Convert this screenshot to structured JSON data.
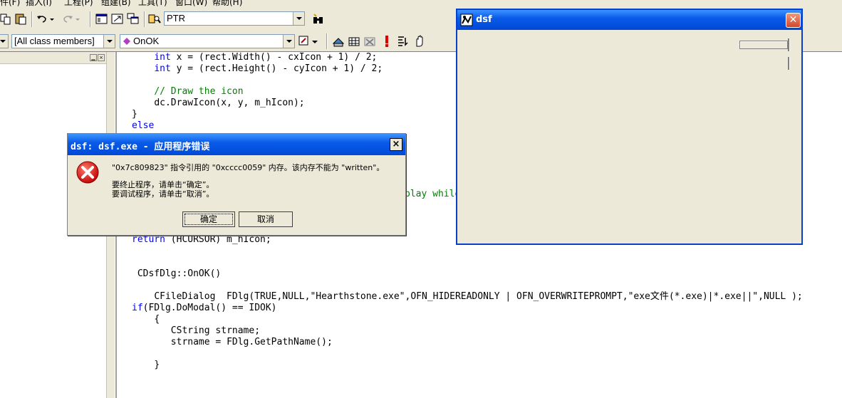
{
  "menu": {
    "items": [
      "件(F)",
      "插入(I)",
      "工程(P)",
      "组建(B)",
      "工具(T)",
      "窗口(W)",
      "帮助(H)"
    ]
  },
  "toolbar": {
    "find_combo_value": "PTR",
    "class_combo_value": "[All class members]",
    "member_combo_value": "OnOK"
  },
  "editor": {
    "lines": [
      {
        "indent": "    ",
        "kw": "int",
        "text": " x = (rect.Width() - cxIcon + 1) / 2;"
      },
      {
        "indent": "    ",
        "kw": "int",
        "text": " y = (rect.Height() - cyIcon + 1) / 2;"
      },
      {
        "indent": "    ",
        "cm": "// Draw the icon"
      },
      {
        "indent": "    ",
        "text": "dc.DrawIcon(x, y, m_hIcon);"
      },
      {
        "text": "}"
      },
      {
        "kw": "else"
      },
      {
        "cm": "play while"
      },
      {
        "kw": "return",
        "text": " (HCURSOR) m_hIcon;"
      },
      {
        "text": " CDsfDlg::OnOK()"
      },
      {
        "indent": "    ",
        "text": "CFileDialog  FDlg(TRUE,NULL,\"Hearthstone.exe\",OFN_HIDEREADONLY | OFN_OVERWRITEPROMPT,\"exe文件(*.exe)|*.exe||\",NULL );"
      },
      {
        "kw": "if",
        "text": "(FDlg.DoModal() == IDOK)"
      },
      {
        "indent": "    ",
        "text": "{"
      },
      {
        "indent": "       ",
        "text": "CString strname;"
      },
      {
        "indent": "       ",
        "text": "strname = FDlg.GetPathName();"
      },
      {
        "indent": "    ",
        "text": "}"
      }
    ]
  },
  "dsf_window": {
    "title": "dsf",
    "close_label": "✕"
  },
  "error_dialog": {
    "title": "dsf: dsf.exe - 应用程序错误",
    "close_label": "×",
    "message_line1": "\"0x7c809823\" 指令引用的 \"0xcccc0059\" 内存。该内存不能为 \"written\"。",
    "message_line2": "要终止程序，请单击“确定”。",
    "message_line3": "要调试程序，请单击“取消”。",
    "ok_label": "确定",
    "cancel_label": "取消"
  },
  "colors": {
    "xp_title_blue": "#0a5be8",
    "keyword_blue": "#0000ff",
    "comment_green": "#008000",
    "error_red": "#d40000"
  }
}
